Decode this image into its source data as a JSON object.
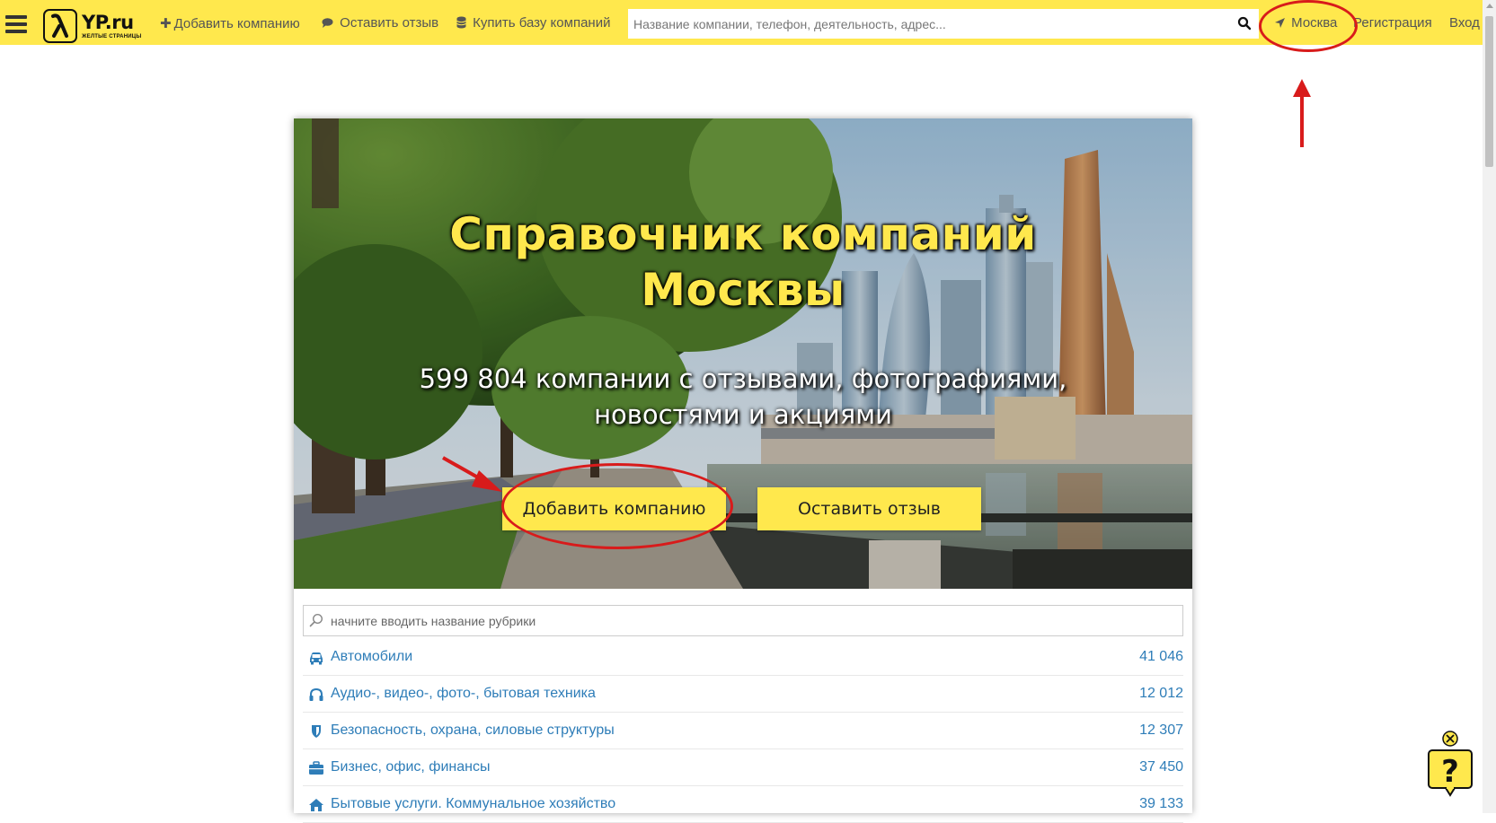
{
  "header": {
    "logo_name": "YP.ru",
    "logo_sub": "ЖЕЛТЫЕ СТРАНИЦЫ",
    "add_company": "Добавить компанию",
    "leave_review": "Оставить отзыв",
    "buy_base": "Купить базу компаний",
    "search_placeholder": "Название компании, телефон, деятельность, адрес...",
    "city": "Москва",
    "register": "Регистрация",
    "login": "Вход"
  },
  "hero": {
    "title_line1": "Справочник компаний",
    "title_line2": "Москвы",
    "subtitle_line1": "599 804 компании с отзывами, фотографиями,",
    "subtitle_line2": "новостями и акциями",
    "btn_add": "Добавить компанию",
    "btn_review": "Оставить отзыв"
  },
  "categories": {
    "search_placeholder": "начните вводить название рубрики",
    "items": [
      {
        "icon": "car-icon",
        "name": "Автомобили",
        "count": "41 046"
      },
      {
        "icon": "headphones-icon",
        "name": "Аудио-, видео-, фото-, бытовая техника",
        "count": "12 012"
      },
      {
        "icon": "shield-icon",
        "name": "Безопасность, охрана, силовые структуры",
        "count": "12 307"
      },
      {
        "icon": "briefcase-icon",
        "name": "Бизнес, офис, финансы",
        "count": "37 450"
      },
      {
        "icon": "home-icon",
        "name": "Бытовые услуги. Коммунальное хозяйство",
        "count": "39 133"
      }
    ]
  },
  "colors": {
    "brand_yellow": "#ffe84d",
    "link_blue": "#2e7db8",
    "annotation_red": "#d81b1b"
  }
}
